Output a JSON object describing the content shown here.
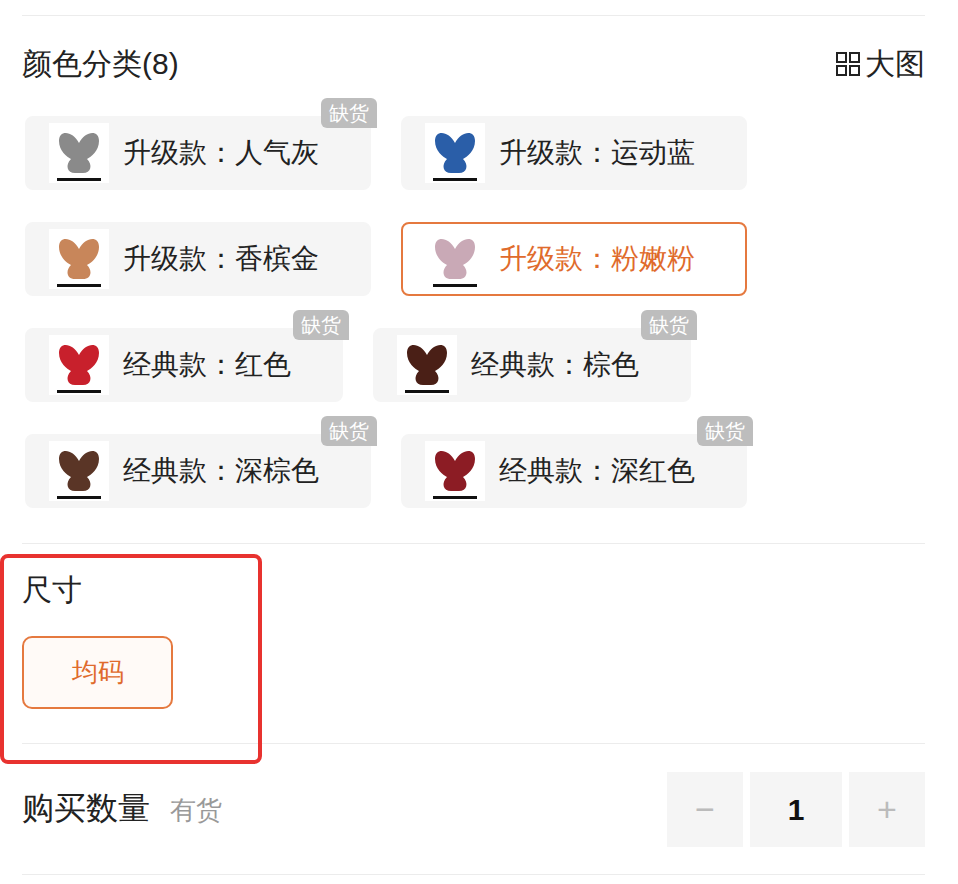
{
  "color_section": {
    "title": "颜色分类(8)",
    "view_large": "大图"
  },
  "out_of_stock_label": "缺货",
  "colors": [
    {
      "label": "升级款：人气灰",
      "selected": false,
      "out_of_stock": true,
      "color": "#8a8a8a"
    },
    {
      "label": "升级款：运动蓝",
      "selected": false,
      "out_of_stock": false,
      "color": "#2a5ea8"
    },
    {
      "label": "升级款：香槟金",
      "selected": false,
      "out_of_stock": false,
      "color": "#c8865a"
    },
    {
      "label": "升级款：粉嫩粉",
      "selected": true,
      "out_of_stock": false,
      "color": "#c9a9b6"
    },
    {
      "label": "经典款：红色",
      "selected": false,
      "out_of_stock": true,
      "color": "#c8202c"
    },
    {
      "label": "经典款：棕色",
      "selected": false,
      "out_of_stock": true,
      "color": "#4a1f16"
    },
    {
      "label": "经典款：深棕色",
      "selected": false,
      "out_of_stock": true,
      "color": "#5a3526"
    },
    {
      "label": "经典款：深红色",
      "selected": false,
      "out_of_stock": true,
      "color": "#8c1c24"
    }
  ],
  "size_section": {
    "title": "尺寸",
    "options": [
      {
        "label": "均码",
        "selected": true
      }
    ]
  },
  "quantity": {
    "label": "购买数量",
    "stock": "有货",
    "minus": "−",
    "value": "1",
    "plus": "+"
  }
}
